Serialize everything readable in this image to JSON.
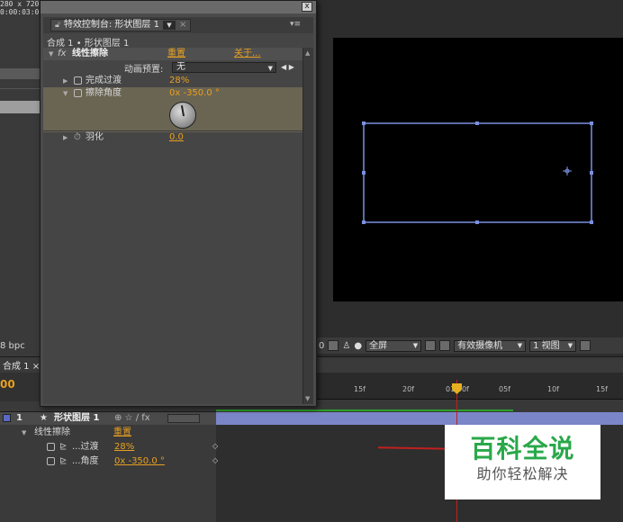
{
  "left_info": {
    "size": "280 x 720",
    "time": "0:00:03:0"
  },
  "bpc": "8 bpc",
  "effect_controls": {
    "tab_label": "特效控制台: 形状图层 1",
    "comp_path": "合成 1 • 形状图层 1",
    "effect_name": "线性擦除",
    "reset_label": "重置",
    "about_label": "关于...",
    "preset_label": "动画预置:",
    "preset_value": "无",
    "params": [
      {
        "label": "完成过渡",
        "value": "28%"
      },
      {
        "label": "擦除角度",
        "value": "0x -350.0 °"
      },
      {
        "label": "羽化",
        "value": "0.0"
      }
    ],
    "close_glyph": "x"
  },
  "viewer_toolbar": {
    "magnification": "0",
    "resolution": "全屏",
    "camera": "有效摄像机",
    "views": "1 视图"
  },
  "timeline": {
    "tab_label": "合成 1",
    "timecode": "00",
    "ruler": [
      "15f",
      "20f",
      "01:00f",
      "05f",
      "10f",
      "15f"
    ],
    "layer_index": "1",
    "layer_name": "形状图层 1",
    "effect_name": "线性擦除",
    "reset_label": "重置",
    "sub_props": [
      {
        "label": "...过渡",
        "value": "28%"
      },
      {
        "label": "...角度",
        "value": "0x -350.0 °"
      }
    ]
  },
  "watermark": {
    "title": "百科全说",
    "subtitle": "助你轻松解决"
  },
  "colors": {
    "accent_orange": "#e8a020",
    "layer_bar": "#7b86c8",
    "shape_outline": "#7b8fe0"
  }
}
